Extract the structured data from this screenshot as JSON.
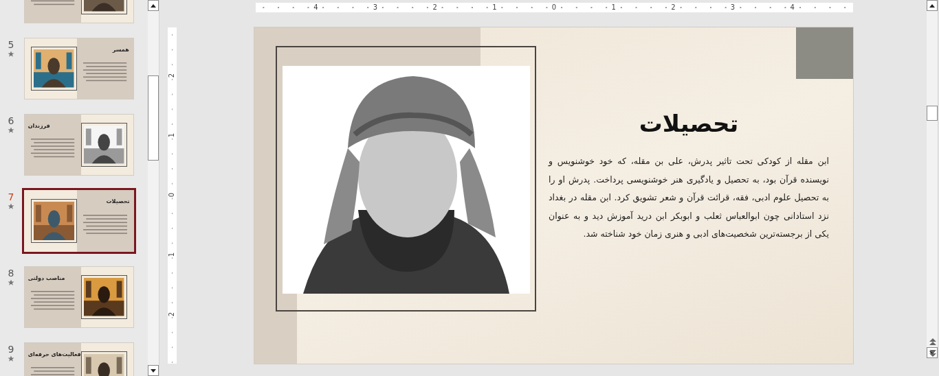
{
  "thumbnails": [
    {
      "kind": "photo-right",
      "selected": false
    },
    {
      "number": "5",
      "title": "همسر",
      "kind": "photo-left",
      "selected": false
    },
    {
      "number": "6",
      "title": "فرزندان",
      "kind": "photo-right",
      "selected": false
    },
    {
      "number": "7",
      "title": "تحصیلات",
      "kind": "photo-left",
      "selected": true
    },
    {
      "number": "8",
      "title": "مناصب دولتی",
      "kind": "photo-right",
      "selected": false
    },
    {
      "number": "9",
      "title": "فعالیت‌های حرفه‌ای",
      "kind": "photo-right",
      "selected": false
    }
  ],
  "ruler": {
    "horizontal": [
      "4",
      "3",
      "2",
      "1",
      "0",
      "1",
      "2",
      "3",
      "4"
    ],
    "vertical": [
      "2",
      "1",
      "0",
      "1",
      "2"
    ]
  },
  "slide": {
    "title": "تحصیلات",
    "body": "ابن مقله از کودکی تحت تاثیر پدرش، علی بن مقله، که خود خوشنویس و نویسنده قرآن بود، به تحصیل و یادگیری هنر خوشنویسی پرداخت. پدرش او را به تحصیل علوم ادبی، فقه، قرائت قرآن و شعر تشویق کرد. ابن مقله در بغداد نزد استادانی چون ابوالعباس ثعلب و ابوبکر ابن درید آموزش دید و به عنوان یکی از برجسته‌ترین شخصیت‌های ادبی و هنری زمان خود شناخته شد."
  }
}
